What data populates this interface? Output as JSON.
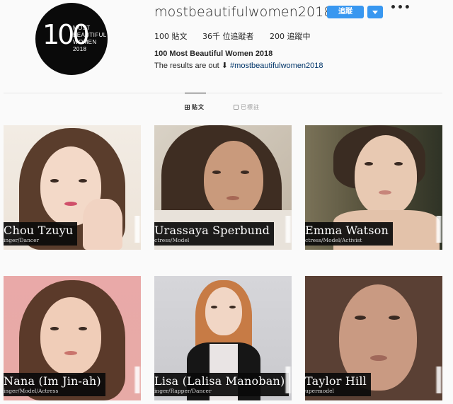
{
  "profile": {
    "avatar_number": "100",
    "avatar_words": [
      "MOST",
      "BEAUTIFUL",
      "WOMEN 2018"
    ],
    "username": "mostbeautifulwomen2018",
    "follow_label": "追蹤",
    "more_icon": "•••",
    "stats": {
      "posts": "100 貼文",
      "followers": "36千 位追蹤者",
      "following": "200 追蹤中"
    },
    "full_name": "100 Most Beautiful Women 2018",
    "bio_text": "The results are out ⬇ ",
    "bio_hashtag": "#mostbeautifulwomen2018"
  },
  "tabs": [
    {
      "label": "貼文",
      "icon": "grid-icon",
      "active": true
    },
    {
      "label": "已標註",
      "icon": "tag-icon",
      "active": false
    }
  ],
  "colors": {
    "accent": "#3897f0",
    "background": "#fafafa",
    "hashtag": "#003569"
  },
  "posts": [
    {
      "name": "Chou Tzuyu",
      "role": "inger/Dancer"
    },
    {
      "name": "Urassaya Sperbund",
      "role": "ctress/Model"
    },
    {
      "name": "Emma Watson",
      "role": "ctress/Model/Activist"
    },
    {
      "name": "Nana (Im Jin-ah)",
      "role": "inger/Model/Actress"
    },
    {
      "name": "Lisa (Lalisa Manoban)",
      "role": "inger/Rapper/Dancer"
    },
    {
      "name": "Taylor Hill",
      "role": "upermodel"
    }
  ]
}
